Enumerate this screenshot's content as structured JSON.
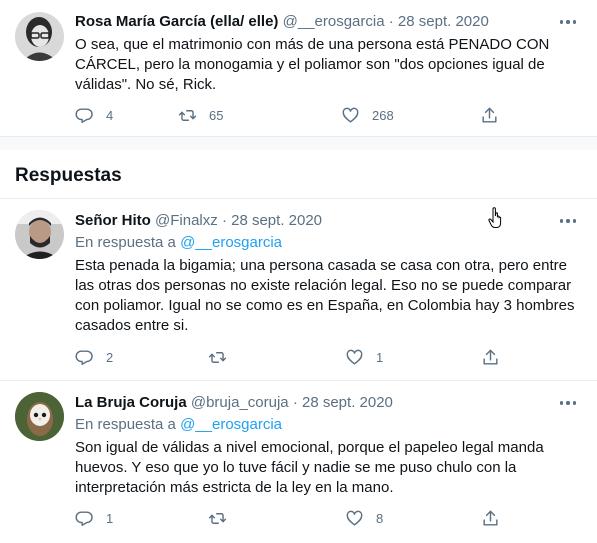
{
  "main_tweet": {
    "author_name": "Rosa María García (ella/ elle)",
    "handle": "@__erosgarcia",
    "dot": "·",
    "date": "28 sept. 2020",
    "text": "O sea, que el matrimonio con más de una persona está PENADO CON CÁRCEL, pero la monogamia y el poliamor son \"dos opciones igual de válidas\". No sé, Rick.",
    "replies": "4",
    "retweets": "65",
    "likes": "268"
  },
  "section_title": "Respuestas",
  "replies": [
    {
      "author_name": "Señor Hito",
      "handle": "@Finalxz",
      "dot": "·",
      "date": "28 sept. 2020",
      "reply_prefix": "En respuesta a",
      "reply_to": "@__erosgarcia",
      "text": "Esta penada la bigamia; una persona casada se casa con otra, pero entre las otras dos personas no existe relación legal. Eso no se puede comparar con poliamor. Igual no se como es en España, en Colombia hay 3 hombres casados entre si.",
      "replies": "2",
      "retweets": "",
      "likes": "1"
    },
    {
      "author_name": "La Bruja Coruja",
      "handle": "@bruja_coruja",
      "dot": "·",
      "date": "28 sept. 2020",
      "reply_prefix": "En respuesta a",
      "reply_to": "@__erosgarcia",
      "text": "Son igual de válidas a nivel emocional, porque el papeleo legal manda huevos. Y eso que yo lo tuve fácil y nadie se me puso chulo con la interpretación más estricta de la ley en la mano.",
      "replies": "1",
      "retweets": "",
      "likes": "8"
    }
  ],
  "icons": {
    "reply": "reply-icon",
    "retweet": "retweet-icon",
    "like": "heart-icon",
    "share": "share-icon",
    "more": "more-icon"
  },
  "colors": {
    "link": "#1da1f2",
    "muted": "#5b7083",
    "text": "#0f1419",
    "separator": "#f7f9fa"
  }
}
